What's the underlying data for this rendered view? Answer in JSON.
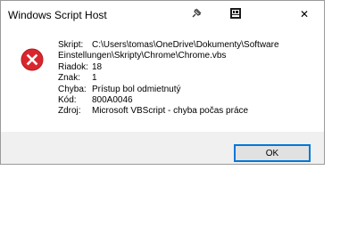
{
  "window": {
    "title": "Windows Script Host",
    "close_glyph": "✕"
  },
  "icons": {
    "titlebar_left": "pin-icon",
    "titlebar_right": "screen-capture-icon",
    "message": "error-icon",
    "error_color": "#d9262d"
  },
  "message": {
    "skript_label": "Skript:",
    "skript_value_line1": "C:\\Users\\tomas\\OneDrive\\Dokumenty\\Software",
    "skript_value_line2": "Einstellungen\\Skripty\\Chrome\\Chrome.vbs",
    "riadok_label": "Riadok:",
    "riadok_value": "18",
    "znak_label": "Znak:",
    "znak_value": "1",
    "chyba_label": "Chyba:",
    "chyba_value": "Prístup bol odmietnutý",
    "kod_label": "Kód:",
    "kod_value": "800A0046",
    "zdroj_label": "Zdroj:",
    "zdroj_value": "Microsoft VBScript - chyba počas práce"
  },
  "buttons": {
    "ok_label": "OK"
  },
  "colors": {
    "focus_border": "#0078d7",
    "footer_bg": "#f0f0f0"
  }
}
